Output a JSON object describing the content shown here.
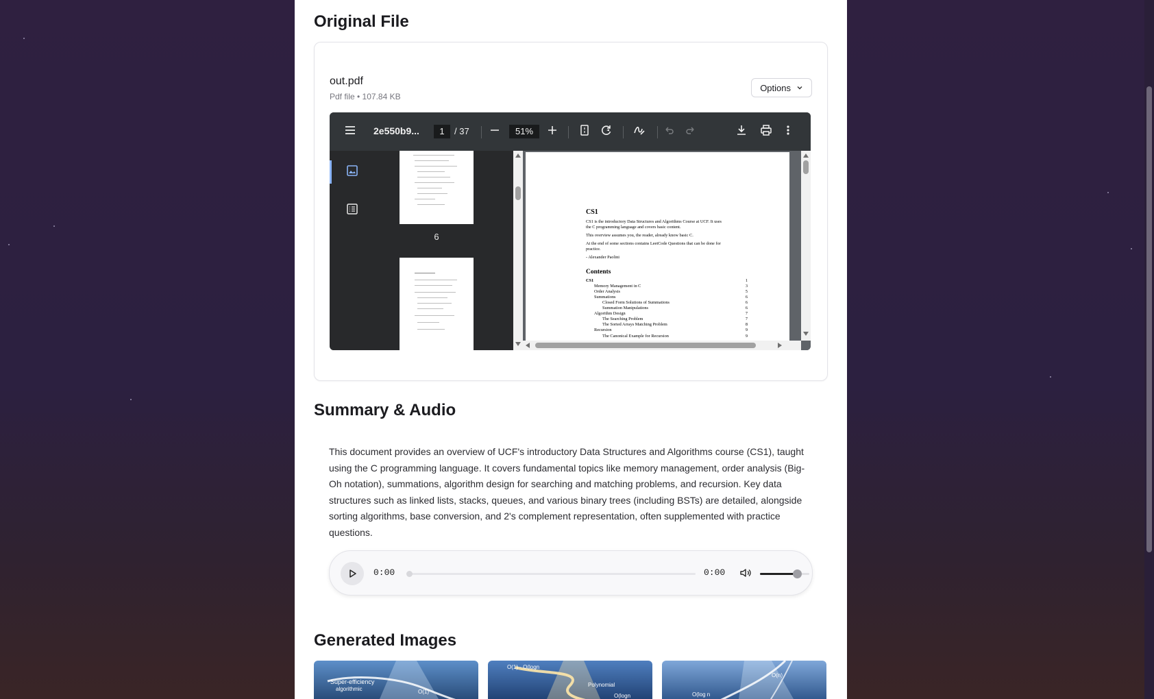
{
  "sections": {
    "original_file": "Original File",
    "summary_audio": "Summary & Audio",
    "generated_images": "Generated Images"
  },
  "file": {
    "name": "out.pdf",
    "meta": "Pdf file • 107.84 KB",
    "options_label": "Options"
  },
  "pdf_viewer": {
    "doc_title": "2e550b9...",
    "current_page": "1",
    "total_pages": "/ 37",
    "zoom": "51%",
    "thumbnail_page_label": "6",
    "page_content": {
      "heading": "CS1",
      "intro_line1": "CS1 is the introductory Data Structures and Algorithms Course at UCF. It uses",
      "intro_line2": "the C programming language and covers basic content.",
      "assume": "This overview assumes you, the reader, already know basic C.",
      "practice_line1": "At the end of some sections contains LeetCode Questions that can be done for",
      "practice_line2": "practice.",
      "author": "- Alexander Paolini",
      "contents_heading": "Contents",
      "toc": [
        {
          "label": "CS1",
          "page": "1"
        },
        {
          "label": "Memory Management in C",
          "page": "3"
        },
        {
          "label": "Order Analysis",
          "page": "5"
        },
        {
          "label": "Summations",
          "page": "6"
        },
        {
          "label": "Closed Form Solutions of Summations",
          "page": "6"
        },
        {
          "label": "Summation Manipulations",
          "page": "6"
        },
        {
          "label": "Algorithm Design",
          "page": "7"
        },
        {
          "label": "The Searching Problem",
          "page": "7"
        },
        {
          "label": "The Sorted Arrays Matching Problem",
          "page": "8"
        },
        {
          "label": "Recursion",
          "page": "9"
        },
        {
          "label": "The Canonical Example for Recursion",
          "page": "9"
        }
      ]
    }
  },
  "summary": {
    "text": "This document provides an overview of UCF's introductory Data Structures and Algorithms course (CS1), taught using the C programming language. It covers fundamental topics like memory management, order analysis (Big-Oh notation), summations, algorithm design for searching and matching problems, and recursion. Key data structures such as linked lists, stacks, queues, and various binary trees (including BSTs) are detailed, alongside sorting algorithms, base conversion, and 2's complement representation, often supplemented with practice questions."
  },
  "audio": {
    "current_time": "0:00",
    "duration": "0:00",
    "progress": 0,
    "volume": 0.75
  },
  "generated_images": [
    {
      "text_1": "Super-efficiency",
      "text_2": "algorithmic",
      "text_3": "O(1)"
    },
    {
      "text_1": "O(1) - O(logn",
      "text_2": "Polynomial",
      "text_3": "O(logn"
    },
    {
      "text_1": "O(log n",
      "text_2": "O(n)"
    }
  ],
  "colors": {
    "background": "#2e2140",
    "panel": "#ffffff",
    "viewer_toolbar": "#323639",
    "accent": "#8ab4f8"
  }
}
